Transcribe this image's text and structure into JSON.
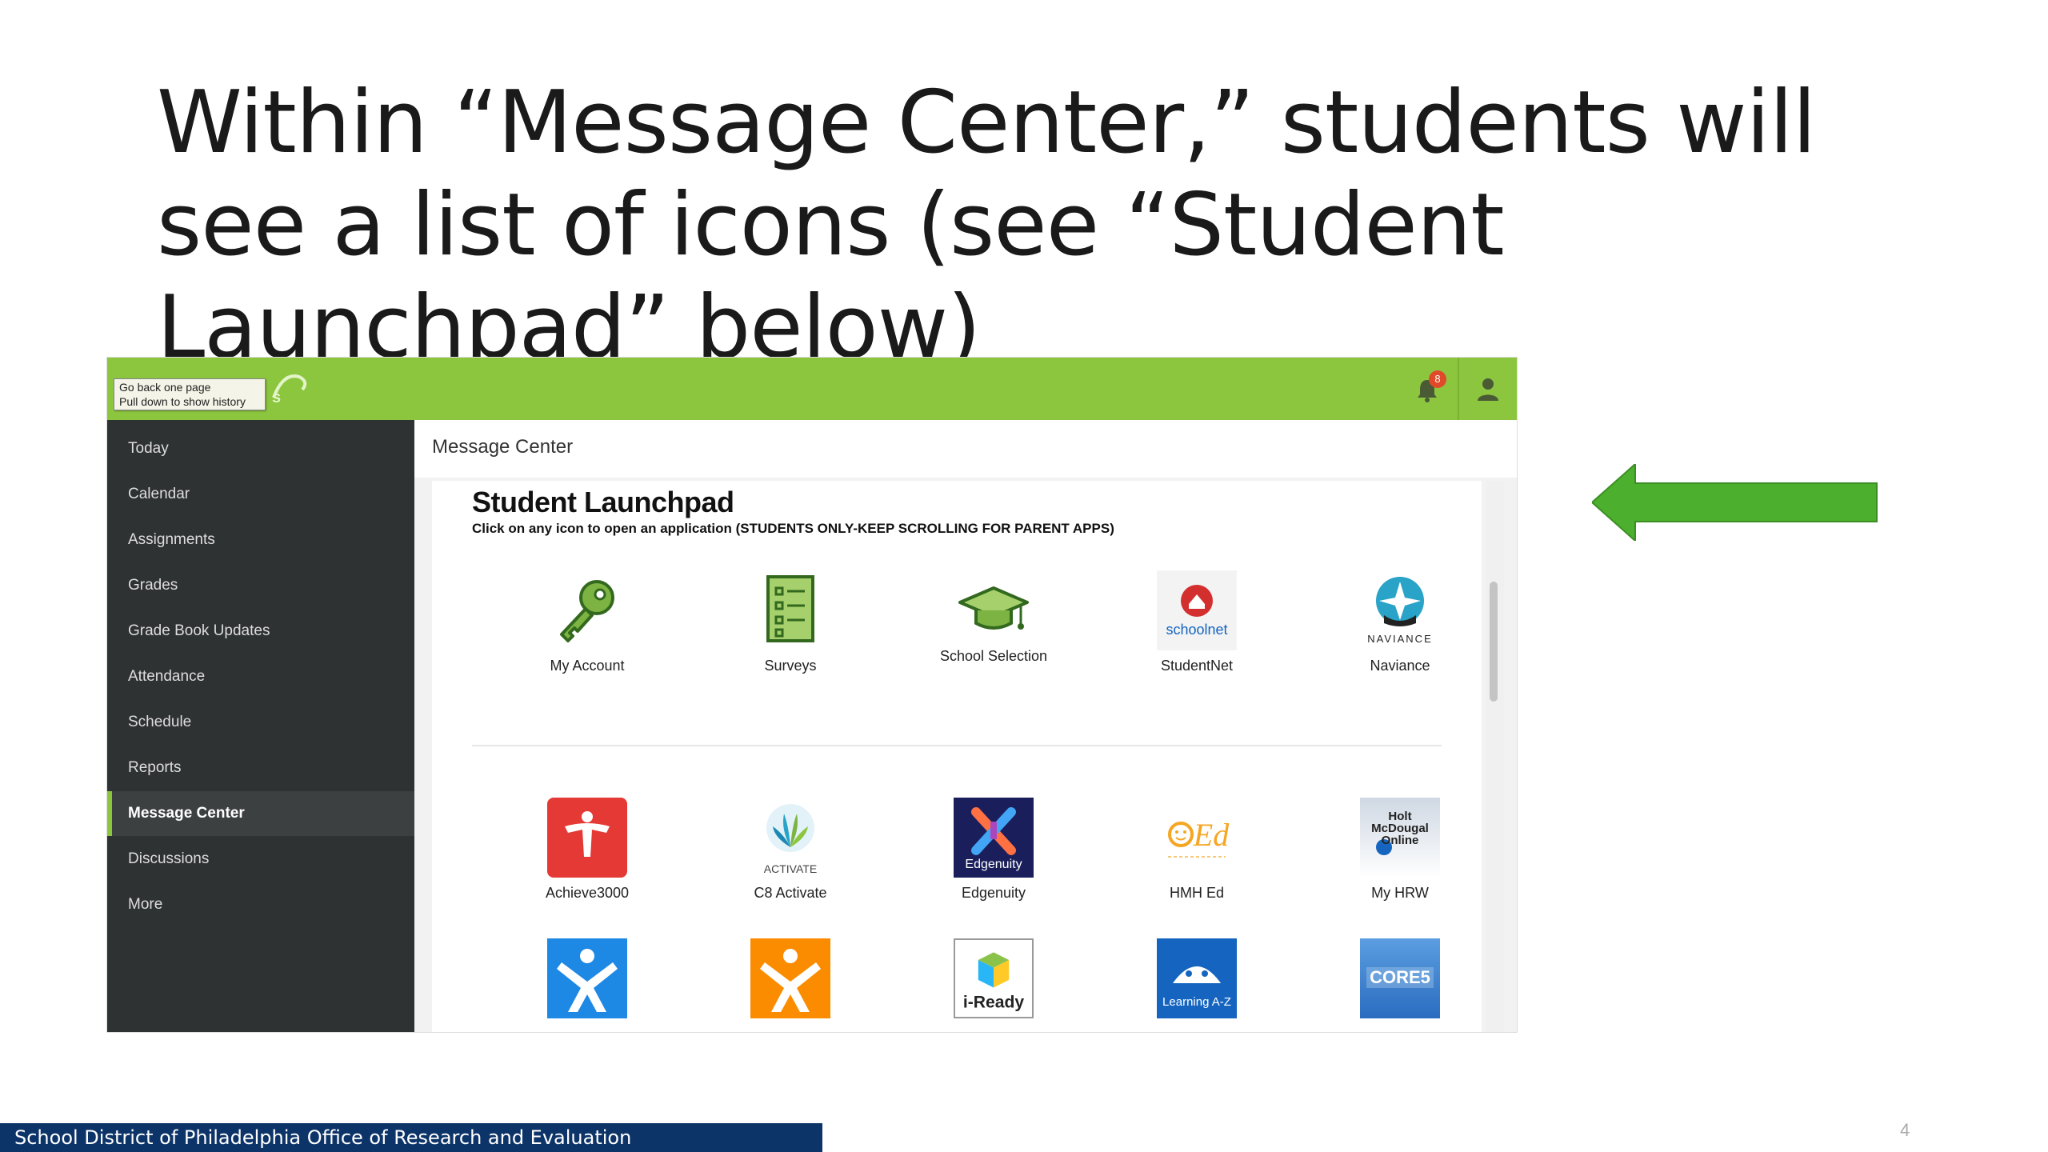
{
  "slide": {
    "title": "Within “Message Center,” students will see a list of icons (see “Student Launchpad” below)",
    "footer": "School District of Philadelphia Office of Research and Evaluation",
    "page_number": "4"
  },
  "app": {
    "tooltip": [
      "Go back one page",
      "Pull down to show history"
    ],
    "notification_count": "8",
    "brand_color": "#8cc63f",
    "sidebar": {
      "items": [
        {
          "label": "Today",
          "icon": "none"
        },
        {
          "label": "Calendar",
          "icon": "none"
        },
        {
          "label": "Assignments",
          "icon": "none"
        },
        {
          "label": "Grades",
          "icon": "none"
        },
        {
          "label": "Grade Book Updates",
          "icon": "none"
        },
        {
          "label": "Attendance",
          "icon": "none"
        },
        {
          "label": "Schedule",
          "icon": "none"
        },
        {
          "label": "Reports",
          "icon": "none"
        },
        {
          "label": "Message Center",
          "icon": "none",
          "active": true
        },
        {
          "label": "Discussions",
          "icon": "none"
        },
        {
          "label": "More",
          "icon": "none"
        }
      ]
    },
    "content_header": "Message Center",
    "launchpad": {
      "title": "Student Launchpad",
      "subtitle": "Click on any icon to open an application (STUDENTS ONLY-KEEP SCROLLING FOR PARENT APPS)",
      "row1": [
        {
          "label": "My Account",
          "icon": "key-icon"
        },
        {
          "label": "Surveys",
          "icon": "survey-icon"
        },
        {
          "label": "School Selection",
          "icon": "graduation-cap-icon"
        },
        {
          "label": "StudentNet",
          "icon": "schoolnet-icon",
          "icon_text": "schoolnet"
        },
        {
          "label": "Naviance",
          "icon": "naviance-icon",
          "icon_text": "NAVIANCE"
        }
      ],
      "row2": [
        {
          "label": "Achieve3000",
          "icon": "achieve3000-icon"
        },
        {
          "label": "C8 Activate",
          "icon": "activate-icon",
          "icon_text": "ACTIVATE"
        },
        {
          "label": "Edgenuity",
          "icon": "edgenuity-icon",
          "icon_text": "Edgenuity"
        },
        {
          "label": "HMH Ed",
          "icon": "hmh-ed-icon",
          "icon_text": "Ed"
        },
        {
          "label": "My HRW",
          "icon": "holt-icon",
          "icon_text": "Holt McDougal Online"
        }
      ],
      "row3": [
        {
          "icon": "blue-x-app-icon"
        },
        {
          "icon": "orange-x-app-icon"
        },
        {
          "icon": "iready-icon",
          "icon_text": "i-Ready"
        },
        {
          "icon": "learning-az-icon",
          "icon_text": "Learning A-Z"
        },
        {
          "icon": "core5-icon",
          "icon_text": "CORE5"
        }
      ]
    }
  }
}
